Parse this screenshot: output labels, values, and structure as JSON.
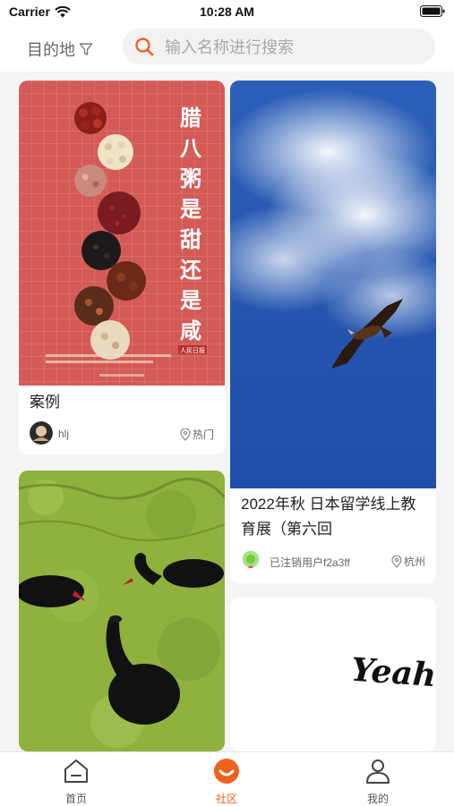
{
  "status_bar": {
    "carrier": "Carrier",
    "time": "10:28 AM"
  },
  "header": {
    "destination_label": "目的地",
    "search_placeholder": "输入名称进行搜索"
  },
  "colors": {
    "accent": "#f0621f",
    "location_green": "#7ac943"
  },
  "feed": {
    "cards": [
      {
        "title": "案例",
        "user": "hlj",
        "location": "热门",
        "image": "laba-congee-poster"
      },
      {
        "title": "2022年秋 日本留学线上教育展（第六回",
        "user": "已注销用户f2a3ff",
        "location": "杭州",
        "image": "kite-in-blue-sky"
      },
      {
        "title": "",
        "user": "",
        "location": "",
        "image": "black-swans-on-pond"
      },
      {
        "title": "",
        "user": "",
        "location": "",
        "image": "yeah-lettering",
        "image_text": "Yeah!"
      }
    ],
    "poster_title": "腊八粥是甜还是咸",
    "poster_brand": "人民日报"
  },
  "tab_bar": {
    "items": [
      {
        "label": "首页",
        "icon": "home-icon"
      },
      {
        "label": "社区",
        "icon": "community-icon",
        "active": true
      },
      {
        "label": "我的",
        "icon": "profile-icon"
      }
    ]
  }
}
